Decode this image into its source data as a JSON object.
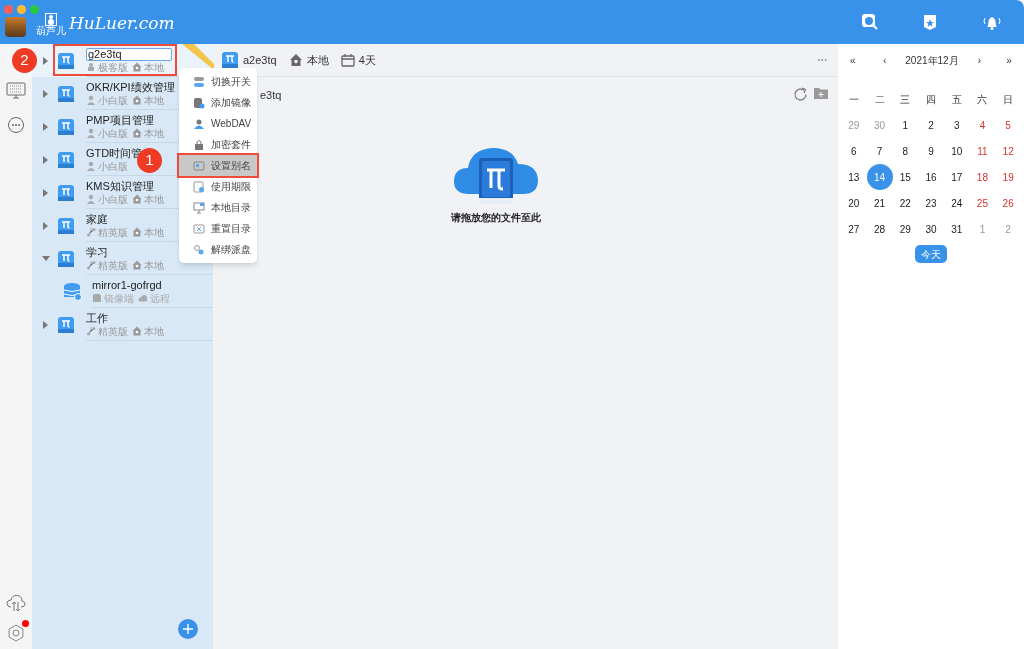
{
  "app": {
    "logo_text": "HuLuer.com",
    "logo_caption": "葫芦儿"
  },
  "tree": [
    {
      "name": "g2e3tq",
      "editing": true,
      "selected": true,
      "expanded": false,
      "meta": [
        {
          "kind": "geek",
          "label": "极客版"
        },
        {
          "kind": "local",
          "label": "本地"
        }
      ]
    },
    {
      "name": "OKR/KPI绩效管理",
      "editing": false,
      "selected": false,
      "expanded": false,
      "meta": [
        {
          "kind": "novice",
          "label": "小白版"
        },
        {
          "kind": "local",
          "label": "本地"
        }
      ]
    },
    {
      "name": "PMP项目管理",
      "editing": false,
      "selected": false,
      "expanded": false,
      "meta": [
        {
          "kind": "novice",
          "label": "小白版"
        },
        {
          "kind": "local",
          "label": "本地"
        }
      ]
    },
    {
      "name": "GTD时间管",
      "editing": false,
      "selected": false,
      "expanded": false,
      "meta": [
        {
          "kind": "novice",
          "label": "小白版"
        }
      ]
    },
    {
      "name": "KMS知识管理",
      "editing": false,
      "selected": false,
      "expanded": false,
      "meta": [
        {
          "kind": "novice",
          "label": "小白版"
        },
        {
          "kind": "local",
          "label": "本地"
        }
      ]
    },
    {
      "name": "家庭",
      "editing": false,
      "selected": false,
      "expanded": false,
      "meta": [
        {
          "kind": "elite",
          "label": "精英版"
        },
        {
          "kind": "local",
          "label": "本地"
        }
      ]
    },
    {
      "name": "学习",
      "editing": false,
      "selected": false,
      "expanded": true,
      "meta": [
        {
          "kind": "elite",
          "label": "精英版"
        },
        {
          "kind": "local",
          "label": "本地"
        }
      ],
      "children": [
        {
          "name": "mirror1-gofrgd",
          "meta": [
            {
              "kind": "mirror",
              "label": "镜像端"
            },
            {
              "kind": "remote",
              "label": "远程"
            }
          ]
        }
      ]
    },
    {
      "name": "工作",
      "editing": false,
      "selected": false,
      "expanded": false,
      "meta": [
        {
          "kind": "elite",
          "label": "精英版"
        },
        {
          "kind": "local",
          "label": "本地"
        }
      ]
    }
  ],
  "context_menu": [
    {
      "kind": "toggle",
      "label": "切换开关",
      "selected": false
    },
    {
      "kind": "mirror",
      "label": "添加镜像",
      "selected": false
    },
    {
      "kind": "webdav",
      "label": "WebDAV",
      "selected": false
    },
    {
      "kind": "lock",
      "label": "加密套件",
      "selected": false
    },
    {
      "kind": "alias",
      "label": "设置别名",
      "selected": true
    },
    {
      "kind": "expiry",
      "label": "使用期限",
      "selected": false
    },
    {
      "kind": "localdir",
      "label": "本地目录",
      "selected": false
    },
    {
      "kind": "resetdir",
      "label": "重置目录",
      "selected": false
    },
    {
      "kind": "unbind",
      "label": "解绑派盘",
      "selected": false
    }
  ],
  "annotations": [
    {
      "label": "2"
    },
    {
      "label": "1"
    }
  ],
  "main": {
    "header": [
      {
        "kind": "disk",
        "label": "a2e3tq"
      },
      {
        "kind": "local",
        "label": "本地"
      },
      {
        "kind": "days",
        "label": "4天"
      }
    ],
    "more": "•••",
    "path": "e3tq",
    "drop_hint": "请拖放您的文件至此"
  },
  "calendar": {
    "prev_year": "«",
    "prev_month": "‹",
    "title": "2021年12月",
    "next_month": "›",
    "next_year": "»",
    "weekdays": [
      "一",
      "二",
      "三",
      "四",
      "五",
      "六",
      "日"
    ],
    "days": [
      {
        "day": "29",
        "kind": "other",
        "selected": false
      },
      {
        "day": "30",
        "kind": "other",
        "selected": false
      },
      {
        "day": "1",
        "kind": "normal",
        "selected": false
      },
      {
        "day": "2",
        "kind": "normal",
        "selected": false
      },
      {
        "day": "3",
        "kind": "normal",
        "selected": false
      },
      {
        "day": "4",
        "kind": "weekend",
        "selected": false
      },
      {
        "day": "5",
        "kind": "weekend",
        "selected": false
      },
      {
        "day": "6",
        "kind": "normal",
        "selected": false
      },
      {
        "day": "7",
        "kind": "normal",
        "selected": false
      },
      {
        "day": "8",
        "kind": "normal",
        "selected": false
      },
      {
        "day": "9",
        "kind": "normal",
        "selected": false
      },
      {
        "day": "10",
        "kind": "normal",
        "selected": false
      },
      {
        "day": "11",
        "kind": "weekend",
        "selected": false
      },
      {
        "day": "12",
        "kind": "weekend",
        "selected": false
      },
      {
        "day": "13",
        "kind": "normal",
        "selected": false
      },
      {
        "day": "14",
        "kind": "normal",
        "selected": true
      },
      {
        "day": "15",
        "kind": "normal",
        "selected": false
      },
      {
        "day": "16",
        "kind": "normal",
        "selected": false
      },
      {
        "day": "17",
        "kind": "normal",
        "selected": false
      },
      {
        "day": "18",
        "kind": "weekend",
        "selected": false
      },
      {
        "day": "19",
        "kind": "weekend",
        "selected": false
      },
      {
        "day": "20",
        "kind": "normal",
        "selected": false
      },
      {
        "day": "21",
        "kind": "normal",
        "selected": false
      },
      {
        "day": "22",
        "kind": "normal",
        "selected": false
      },
      {
        "day": "23",
        "kind": "normal",
        "selected": false
      },
      {
        "day": "24",
        "kind": "normal",
        "selected": false
      },
      {
        "day": "25",
        "kind": "weekend",
        "selected": false
      },
      {
        "day": "26",
        "kind": "weekend",
        "selected": false
      },
      {
        "day": "27",
        "kind": "normal",
        "selected": false
      },
      {
        "day": "28",
        "kind": "normal",
        "selected": false
      },
      {
        "day": "29",
        "kind": "normal",
        "selected": false
      },
      {
        "day": "30",
        "kind": "normal",
        "selected": false
      },
      {
        "day": "31",
        "kind": "normal",
        "selected": false
      },
      {
        "day": "1",
        "kind": "other",
        "selected": false
      },
      {
        "day": "2",
        "kind": "other",
        "selected": false
      }
    ],
    "today_button": "今天"
  },
  "settings_badge": true
}
